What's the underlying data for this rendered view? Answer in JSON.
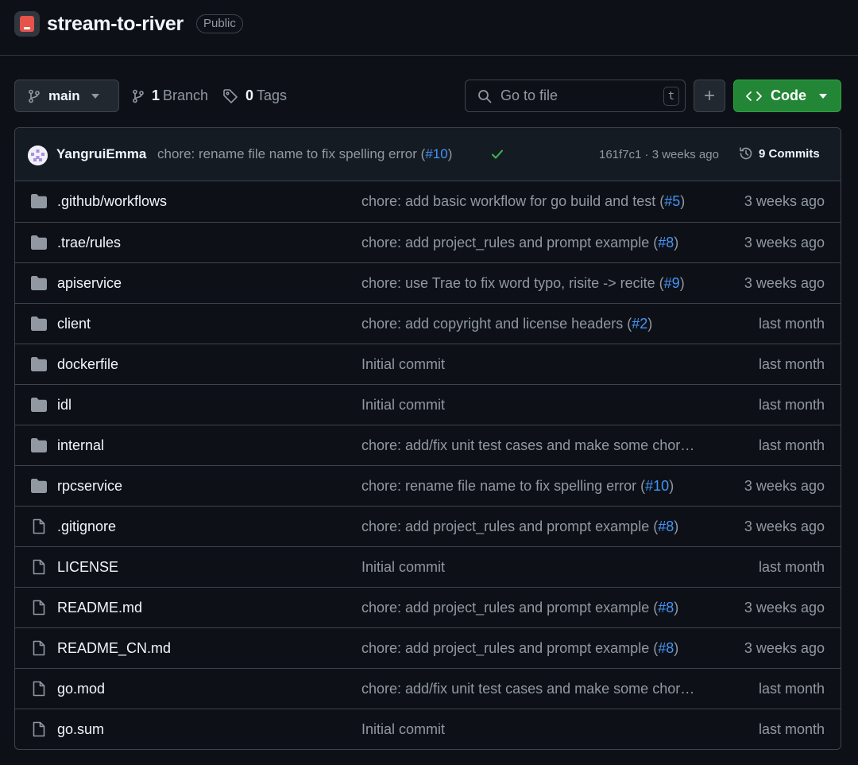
{
  "repo": {
    "name": "stream-to-river",
    "visibility": "Public"
  },
  "toolbar": {
    "branch_label": "main",
    "branches_count": "1",
    "branches_label": "Branch",
    "tags_count": "0",
    "tags_label": "Tags",
    "search_placeholder": "Go to file",
    "search_shortcut": "t",
    "add_label": "+",
    "code_label": "Code"
  },
  "latest_commit": {
    "author": "YangruiEmma",
    "message": "chore: rename file name to fix spelling error (",
    "pr": "#10",
    "message_end": ")",
    "hash_time": "161f7c1 · 3 weeks ago",
    "commits_label": "9 Commits"
  },
  "files": [
    {
      "name": ".github/workflows",
      "type": "dir",
      "msg": "chore: add basic workflow for go build and test (",
      "pr": "#5",
      "end": ")",
      "age": "3 weeks ago"
    },
    {
      "name": ".trae/rules",
      "type": "dir",
      "msg": "chore: add project_rules and prompt example (",
      "pr": "#8",
      "end": ")",
      "age": "3 weeks ago"
    },
    {
      "name": "apiservice",
      "type": "dir",
      "msg": "chore: use Trae to fix word typo, risite -> recite (",
      "pr": "#9",
      "end": ")",
      "age": "3 weeks ago"
    },
    {
      "name": "client",
      "type": "dir",
      "msg": "chore: add copyright and license headers (",
      "pr": "#2",
      "end": ")",
      "age": "last month"
    },
    {
      "name": "dockerfile",
      "type": "dir",
      "msg": "Initial commit",
      "pr": "",
      "end": "",
      "age": "last month"
    },
    {
      "name": "idl",
      "type": "dir",
      "msg": "Initial commit",
      "pr": "",
      "end": "",
      "age": "last month"
    },
    {
      "name": "internal",
      "type": "dir",
      "msg": "chore: add/fix unit test cases and make some chor…",
      "pr": "",
      "end": "",
      "age": "last month"
    },
    {
      "name": "rpcservice",
      "type": "dir",
      "msg": "chore: rename file name to fix spelling error (",
      "pr": "#10",
      "end": ")",
      "age": "3 weeks ago"
    },
    {
      "name": ".gitignore",
      "type": "file",
      "msg": "chore: add project_rules and prompt example (",
      "pr": "#8",
      "end": ")",
      "age": "3 weeks ago"
    },
    {
      "name": "LICENSE",
      "type": "file",
      "msg": "Initial commit",
      "pr": "",
      "end": "",
      "age": "last month"
    },
    {
      "name": "README.md",
      "type": "file",
      "msg": "chore: add project_rules and prompt example (",
      "pr": "#8",
      "end": ")",
      "age": "3 weeks ago"
    },
    {
      "name": "README_CN.md",
      "type": "file",
      "msg": "chore: add project_rules and prompt example (",
      "pr": "#8",
      "end": ")",
      "age": "3 weeks ago"
    },
    {
      "name": "go.mod",
      "type": "file",
      "msg": "chore: add/fix unit test cases and make some chor…",
      "pr": "",
      "end": "",
      "age": "last month"
    },
    {
      "name": "go.sum",
      "type": "file",
      "msg": "Initial commit",
      "pr": "",
      "end": "",
      "age": "last month"
    }
  ],
  "colors": {
    "accent_green": "#238636",
    "link": "#4493f8",
    "muted": "#9198a1"
  }
}
